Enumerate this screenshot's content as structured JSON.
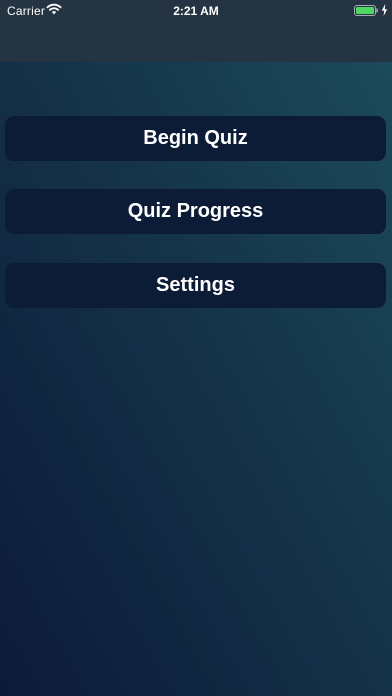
{
  "status_bar": {
    "carrier": "Carrier",
    "time": "2:21 AM",
    "wifi_icon": "wifi-icon",
    "battery_icon": "battery-icon",
    "charging_icon": "charging-bolt-icon",
    "battery_color": "#4cd964"
  },
  "menu": {
    "begin_quiz_label": "Begin Quiz",
    "quiz_progress_label": "Quiz Progress",
    "settings_label": "Settings"
  },
  "colors": {
    "top_bar": "#253442",
    "button_background": "#0c1b36",
    "gradient_bottom_left": "#0c1a38",
    "gradient_top_right": "#1c4d5c"
  }
}
